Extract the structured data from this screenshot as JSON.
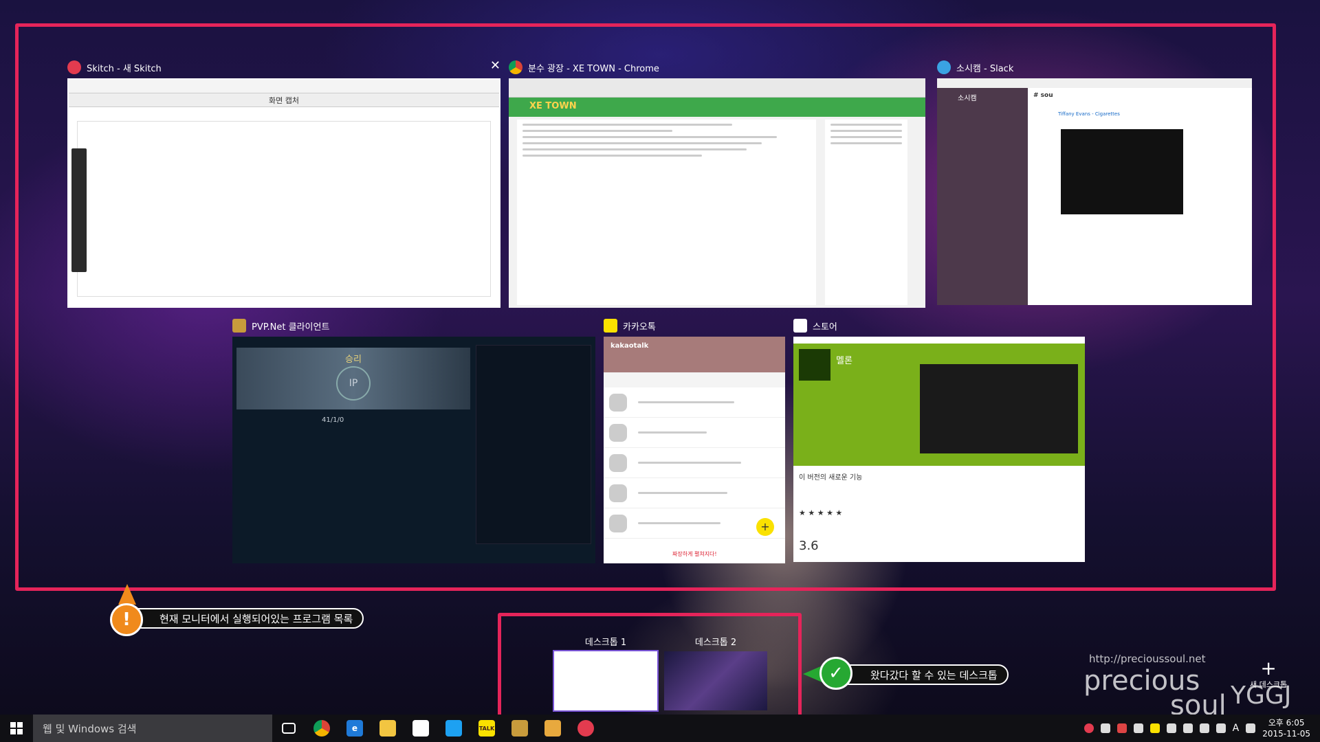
{
  "colors": {
    "highlight": "#e5245a",
    "warning": "#f08a1c",
    "ok": "#26a832",
    "xe_green": "#3ea84b",
    "slack_purple": "#4d394b",
    "kakao_yellow": "#fae100",
    "store_green": "#7ab01a"
  },
  "windows": [
    {
      "title": "Skitch - 새 Skitch",
      "icon": "skitch-icon",
      "toolbar": "화면 캡처"
    },
    {
      "title": "분수 광장 - XE TOWN - Chrome",
      "icon": "chrome-icon",
      "logo": "XE TOWN"
    },
    {
      "title": "소시캠 - Slack",
      "icon": "slack-icon",
      "team": "소시캠",
      "channel": "# sou",
      "video_title": "Tiffany Evans - Cigarettes"
    },
    {
      "title": "PVP.Net 클라이언트",
      "icon": "lol-icon",
      "result": "승리",
      "ip": "IP",
      "score": "41/1/0"
    },
    {
      "title": "카카오톡",
      "icon": "kakaotalk-icon",
      "app_name": "kakaotalk",
      "banner": "짜장하게 펼쳐지다!"
    },
    {
      "title": "스토어",
      "icon": "store-icon",
      "app_name": "멜론",
      "section": "이 버전의 새로운 기능",
      "rating": "3.6",
      "stars": "★ ★ ★ ★ ★"
    }
  ],
  "annotations": {
    "programs": "현재 모니터에서 실행되어있는 프로그램 목록",
    "desktops": "왔다갔다 할 수 있는 데스크톱",
    "warn_mark": "!",
    "ok_mark": "✓"
  },
  "desktops": [
    {
      "label": "데스크톱 1"
    },
    {
      "label": "데스크톱 2"
    }
  ],
  "new_desktop": {
    "plus": "+",
    "label": "새 데스크톱"
  },
  "watermark": {
    "url": "http://precioussoul.net",
    "brand": "precious",
    "soul": "soul",
    "sub": "YGGJ"
  },
  "taskbar": {
    "search_placeholder": "웹 및 Windows 검색",
    "pinned": [
      "task-view-icon",
      "chrome-icon",
      "edge-icon",
      "explorer-icon",
      "store-icon",
      "twitter-icon",
      "kakaotalk-icon",
      "lol-icon",
      "slack-icon",
      "skitch-icon"
    ],
    "talk_label": "TALK",
    "ime": "A",
    "time": "오후 6:05",
    "date": "2015-11-05"
  }
}
